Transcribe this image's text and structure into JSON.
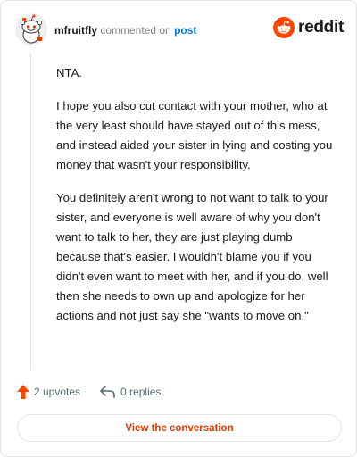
{
  "header": {
    "username": "mfruitfly",
    "action": "commented on",
    "post_link": "post",
    "brand": "reddit"
  },
  "comment": {
    "paragraphs": [
      "NTA.",
      "I hope you also cut contact with your mother, who at the very least should have stayed out of this mess, and instead aided your sister in lying and costing you money that wasn't your responsibility.",
      "You definitely aren't wrong to not want to talk to your sister, and everyone is well aware of why you don't want to talk to her, they are just playing dumb because that's easier. I wouldn't blame you if you didn't even want to meet with her, and if you do, well then she needs to own up and apologize for her actions and not just say she \"wants to move on.\""
    ]
  },
  "footer": {
    "upvotes": "2 upvotes",
    "replies": "0 replies"
  },
  "cta": {
    "label": "View the conversation"
  },
  "colors": {
    "brand_orange": "#ff4500",
    "link_blue": "#0079d3",
    "cta_text": "#d93a00",
    "upvote_icon": "#ff4500",
    "border": "#e2e4e6"
  },
  "icons": {
    "avatar": "snoo-avatar",
    "brand": "reddit-alien-icon",
    "upvote": "upvote-arrow-icon",
    "reply": "reply-arrow-icon"
  }
}
